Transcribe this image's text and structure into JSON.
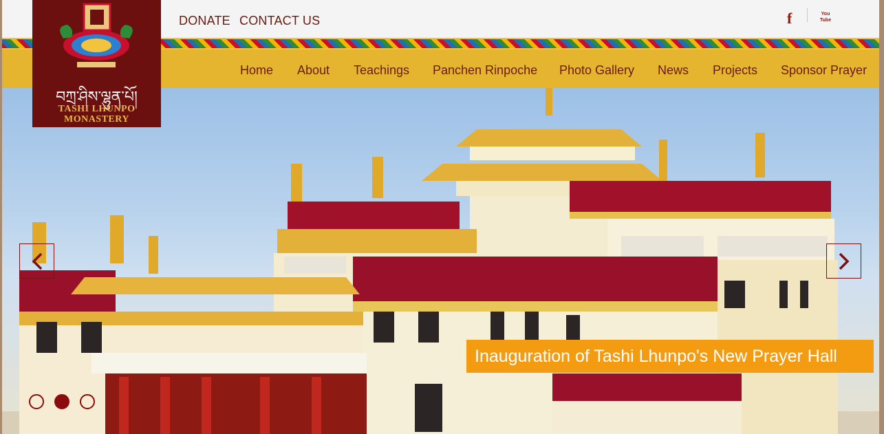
{
  "header": {
    "links": [
      "DONATE",
      "CONTACT US"
    ],
    "social": {
      "facebook": "f",
      "youtube": "You Tube"
    }
  },
  "logo": {
    "tibetan": "བཀྲ་ཤིས་ལྷུན་པོ།",
    "line1": "TASHI LHUNPO",
    "line2": "MONASTERY"
  },
  "nav": {
    "items": [
      "Home",
      "About",
      "Teachings",
      "Panchen Rinpoche",
      "Photo Gallery",
      "News",
      "Projects",
      "Sponsor Prayer"
    ]
  },
  "slider": {
    "caption": "Inauguration of Tashi Lhunpo's New Prayer Hall",
    "dot_count": 3,
    "active_dot": 2
  },
  "colors": {
    "brand_maroon": "#6b0f0f",
    "nav_gold": "#e6b530",
    "caption_orange": "#f39c12",
    "link_text": "#6b1a12"
  }
}
